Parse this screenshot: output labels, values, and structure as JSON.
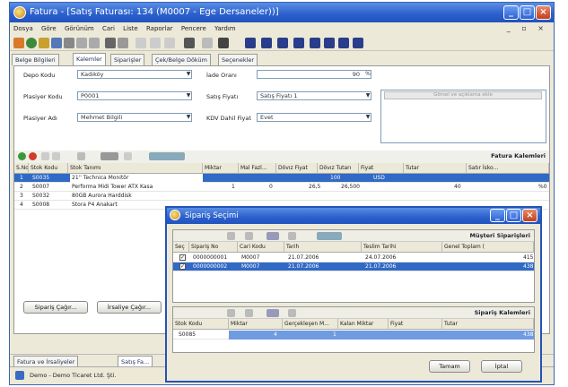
{
  "window": {
    "title": "Fatura - [Satış Faturası: 134 (M0007 - Ege Dersaneler))]",
    "controls": [
      "_",
      "□",
      "×"
    ]
  },
  "menu": [
    "Dosya",
    "Göre",
    "Görünüm",
    "Cari",
    "Liste",
    "Raporlar",
    "Pencere",
    "Yardım"
  ],
  "mdi_controls": "_ ▫ ×",
  "tabs": [
    "Belge Bilgileri",
    "Kalemler",
    "Siparişler",
    "Çek/Belge Döküm",
    "Seçenekler"
  ],
  "form": {
    "depo_kodu": {
      "label": "Depo Kodu",
      "value": "Kadıköy"
    },
    "plasiyer_kodu": {
      "label": "Plasiyer Kodu",
      "value": "P0001"
    },
    "plasiyer_adi": {
      "label": "Plasiyer Adı",
      "value": "Mehmet Bilgili"
    },
    "iade_orani": {
      "label": "İade Oranı",
      "value": "90"
    },
    "satis_fiyati": {
      "label": "Satış Fiyatı",
      "value": "Satış Fiyatı 1"
    },
    "kdv_dahil": {
      "label": "KDV Dahil Fiyat",
      "value": "Evet"
    },
    "note_button": "Görsel ve açıklama ekle"
  },
  "items_grid": {
    "title": "Fatura Kalemleri",
    "columns": [
      "S.No",
      "Stok Kodu",
      "Stok Tanımı",
      "Miktar",
      "Mal Fazl...",
      "Dövız Fiyat",
      "Dövız Tutarı",
      "Fiyat",
      "Tutar",
      "Satır İsko..."
    ],
    "rows": [
      [
        "1",
        "S0035",
        "21'' Technica Monitör",
        "",
        "",
        "100",
        "USD",
        "",
        "",
        ""
      ],
      [
        "2",
        "S0007",
        "Performa Midi Tower ATX Kasa",
        "1",
        "0",
        "26,5",
        "26,500",
        "",
        "40",
        "%0"
      ],
      [
        "3",
        "S0032",
        "80GB Aurora Harddisk",
        "",
        "",
        "",
        "",
        "",
        "",
        ""
      ],
      [
        "4",
        "S0008",
        "Stora P4 Anakart",
        "",
        "",
        "",
        "",
        "",
        "",
        ""
      ]
    ]
  },
  "bottom_buttons": {
    "siparis": "Sipariş Çağır...",
    "irsaliye": "İrsaliye Çağır..."
  },
  "tasks": {
    "tab1": "Fatura ve İrsaliyeler",
    "tab2": "Satış Fa..."
  },
  "status": "Demo - Demo Ticaret Ltd. Şti.",
  "dialog": {
    "title": "Sipariş Seçimi",
    "orders_title": "Müşteri Siparişleri",
    "orders_columns": [
      "Seç",
      "Sipariş No",
      "Cari Kodu",
      "Tarih",
      "Teslim Tarihi",
      "Genel Toplam ("
    ],
    "orders_rows": [
      {
        "checked": "✓",
        "no": "0000000001",
        "cari": "M0007",
        "tarih": "21.07.2006",
        "teslim": "24.07.2006",
        "toplam": "415"
      },
      {
        "checked": "✓",
        "no": "0000000002",
        "cari": "M0007",
        "tarih": "21.07.2006",
        "teslim": "21.07.2006",
        "toplam": "438"
      }
    ],
    "items_title": "Sipariş Kalemleri",
    "items_columns": [
      "Stok Kodu",
      "Miktar",
      "Gerçekleşen M...",
      "Kalan Miktar",
      "Fiyat",
      "Tutar"
    ],
    "items_rows": [
      {
        "kod": "S0085",
        "miktar": "4",
        "gerc": "1",
        "kalan": "",
        "fiyat": "",
        "tutar": "438"
      }
    ],
    "ok": "Tamam",
    "cancel": "İptal"
  },
  "colors": {
    "accent": "#316ac5",
    "titlebar": "#2a5fcc"
  }
}
